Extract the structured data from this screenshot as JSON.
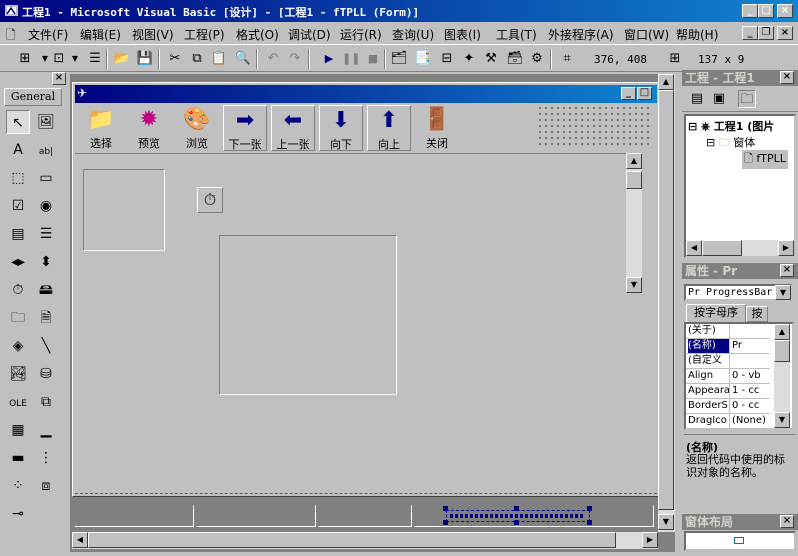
{
  "window": {
    "title": "工程1 - Microsoft Visual Basic [设计] - [工程1 - fTPLL (Form)]",
    "min": "_",
    "max": "□",
    "close": "×"
  },
  "menu": [
    "文件(F)",
    "编辑(E)",
    "视图(V)",
    "工程(P)",
    "格式(O)",
    "调试(D)",
    "运行(R)",
    "查询(U)",
    "图表(I)",
    "工具(T)",
    "外接程序(A)",
    "窗口(W)",
    "帮助(H)"
  ],
  "toolbar": {
    "position": "376, 408",
    "size": "137 x 9"
  },
  "toolbox": {
    "tab": "General",
    "tools": [
      "pointer",
      "picturebox",
      "label",
      "textbox",
      "frame",
      "commandbutton",
      "checkbox",
      "optionbutton",
      "combobox",
      "listbox",
      "hscrollbar",
      "vscrollbar",
      "timer",
      "drivelist",
      "dirlist",
      "filelist",
      "shape",
      "line",
      "image",
      "data",
      "ole",
      "tabstrip",
      "toolbar",
      "statusbar",
      "progressbar",
      "treeview",
      "listview",
      "imagelist",
      "slider"
    ]
  },
  "form": {
    "buttons": [
      {
        "label": "选择",
        "icon": "folder-icon"
      },
      {
        "label": "预览",
        "icon": "starburst-icon"
      },
      {
        "label": "浏览",
        "icon": "palette-icon"
      },
      {
        "label": "下一张",
        "icon": "arrow-right-icon"
      },
      {
        "label": "上一张",
        "icon": "arrow-left-icon"
      },
      {
        "label": "向下",
        "icon": "arrow-down-icon"
      },
      {
        "label": "向上",
        "icon": "arrow-up-icon"
      },
      {
        "label": "关闭",
        "icon": "exit-icon"
      }
    ]
  },
  "project": {
    "title": "工程 - 工程1",
    "root": "工程1 (图片",
    "folder": "窗体",
    "form": "fTPLL"
  },
  "properties": {
    "title": "属性 - Pr",
    "object": "Pr ProgressBar",
    "tab_alpha": "按字母序",
    "tab_cat": "按",
    "rows": [
      {
        "name": "(关于)",
        "value": ""
      },
      {
        "name": "(名称)",
        "value": "Pr"
      },
      {
        "name": "(自定义",
        "value": ""
      },
      {
        "name": "Align",
        "value": "0 - vb"
      },
      {
        "name": "Appeara",
        "value": "1 - cc"
      },
      {
        "name": "BorderS",
        "value": "0 - cc"
      },
      {
        "name": "DragIco",
        "value": "(None)"
      }
    ],
    "desc_title": "(名称)",
    "desc_text": "返回代码中使用的标识对象的名称。"
  },
  "layout_panel": {
    "title": "窗体布局"
  }
}
